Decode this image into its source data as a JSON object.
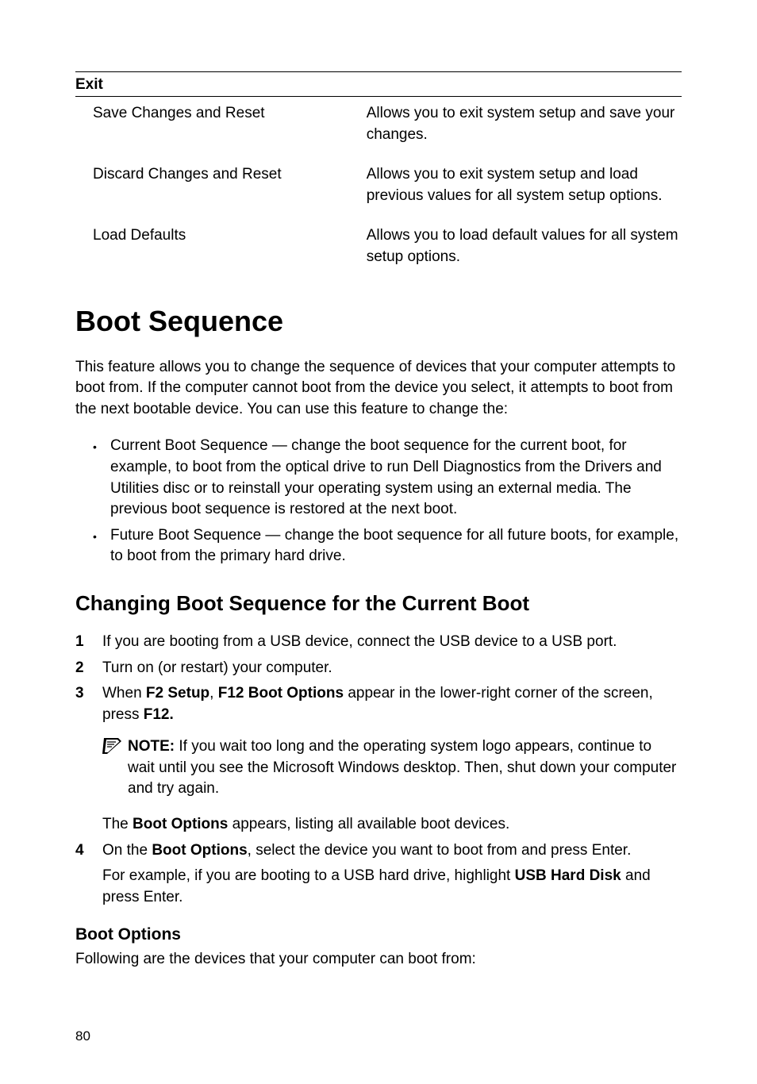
{
  "exit": {
    "header": "Exit",
    "rows": [
      {
        "label": "Save Changes and Reset",
        "desc": "Allows you to exit system setup and save your changes."
      },
      {
        "label": "Discard Changes and Reset",
        "desc": "Allows you to exit system setup and load previous values for all system setup options."
      },
      {
        "label": "Load Defaults",
        "desc": "Allows you to load default values for all system setup options."
      }
    ]
  },
  "h1": "Boot Sequence",
  "intro": "This feature allows you to change the sequence of devices that your computer attempts to boot from. If the computer cannot boot from the device you select, it attempts to boot from the next bootable device. You can use this feature to change the:",
  "bullets": [
    "Current Boot Sequence — change the boot sequence for the current boot, for example, to boot from the optical drive to run Dell Diagnostics from the Drivers and Utilities disc or to reinstall your operating system using an external media. The previous boot sequence is restored at the next boot.",
    "Future Boot Sequence — change the boot sequence for all future boots, for example, to boot from the primary hard drive."
  ],
  "h2": "Changing Boot Sequence for the Current Boot",
  "steps": {
    "s1": "If you are booting from a USB device, connect the USB device to a USB port.",
    "s2": "Turn on (or restart) your computer.",
    "s3_pre": "When ",
    "s3_b1": "F2 Setup",
    "s3_sep": ", ",
    "s3_b2": "F12 Boot Options",
    "s3_mid": " appear in the lower-right corner of the screen, press ",
    "s3_b3": "F12.",
    "note_label": "NOTE:",
    "note_text": " If you wait too long and the operating system logo appears, continue to wait until you see the Microsoft Windows desktop. Then, shut down your computer and try again.",
    "s3_after_pre": "The ",
    "s3_after_b": "Boot Options",
    "s3_after_post": " appears, listing all available boot devices.",
    "s4_pre": "On the ",
    "s4_b": "Boot Options",
    "s4_post": ", select the device you want to boot from and press Enter.",
    "s4_ex_pre": "For example, if you are booting to a USB hard drive, highlight ",
    "s4_ex_b": "USB Hard Disk",
    "s4_ex_post": " and press Enter."
  },
  "h3": "Boot Options",
  "following": "Following are the devices that your computer can boot from:",
  "page": "80",
  "nums": {
    "n1": "1",
    "n2": "2",
    "n3": "3",
    "n4": "4"
  }
}
